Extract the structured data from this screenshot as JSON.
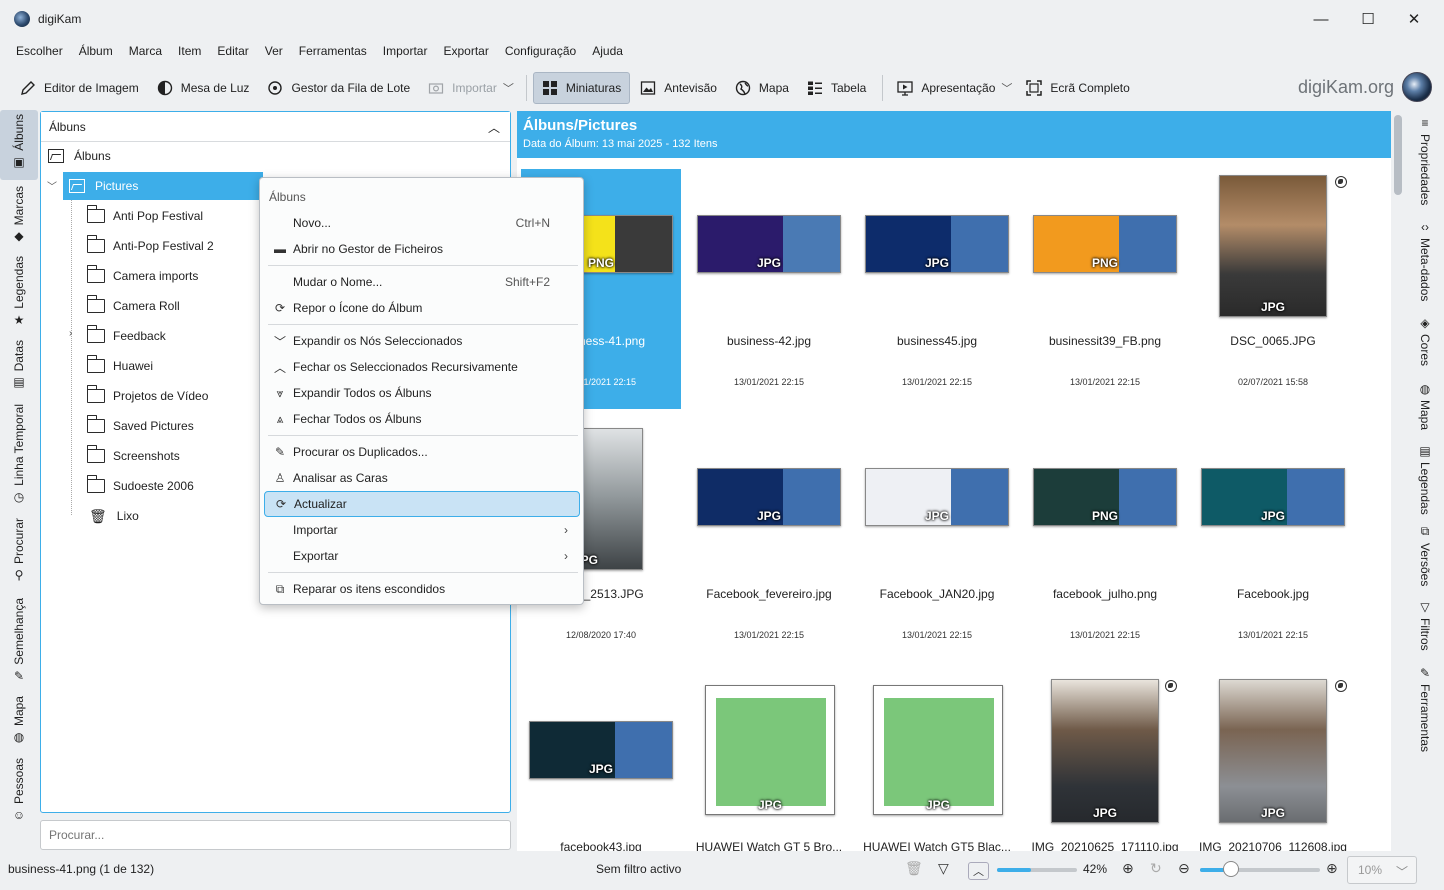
{
  "window": {
    "title": "digiKam",
    "controls": {
      "minimize": "—",
      "maximize": "☐",
      "close": "✕"
    }
  },
  "menubar": [
    "Escolher",
    "Álbum",
    "Marca",
    "Item",
    "Editar",
    "Ver",
    "Ferramentas",
    "Importar",
    "Exportar",
    "Configuração",
    "Ajuda"
  ],
  "toolbar": {
    "image_editor": "Editor de Imagem",
    "light_table": "Mesa de Luz",
    "batch_queue": "Gestor da Fila de Lote",
    "import": "Importar",
    "thumbnails": "Miniaturas",
    "preview": "Antevisão",
    "map": "Mapa",
    "table": "Tabela",
    "slideshow": "Apresentação",
    "fullscreen": "Ecrã Completo",
    "brand": "digiKam.org"
  },
  "left_tabs": [
    "Álbuns",
    "Marcas",
    "Legendas",
    "Datas",
    "Linha Temporal",
    "Procurar",
    "Semelhança",
    "Mapa",
    "Pessoas"
  ],
  "right_tabs": [
    "Propriedades",
    "Meta-dados",
    "Cores",
    "Mapa",
    "Legendas",
    "Versões",
    "Filtros",
    "Ferramentas"
  ],
  "tree": {
    "header": "Álbuns",
    "root": "Álbuns",
    "selected": "Pictures",
    "children": [
      "Anti Pop Festival",
      "Anti-Pop Festival 2",
      "Camera imports",
      "Camera Roll",
      "Feedback",
      "Huawei",
      "Projetos de Vídeo",
      "Saved Pictures",
      "Screenshots",
      "Sudoeste 2006",
      "Lixo"
    ]
  },
  "search": {
    "placeholder": "Procurar..."
  },
  "content": {
    "title": "Álbuns/Pictures",
    "subtitle": "Data do Álbum: 13 mai 2025 - 132 Itens"
  },
  "thumbnails": [
    {
      "name": "business-41.png",
      "date": "13/01/2021 22:15",
      "badge": "PNG",
      "selected": true
    },
    {
      "name": "business-42.jpg",
      "date": "13/01/2021 22:15",
      "badge": "JPG"
    },
    {
      "name": "business45.jpg",
      "date": "13/01/2021 22:15",
      "badge": "JPG"
    },
    {
      "name": "businessit39_FB.png",
      "date": "13/01/2021 22:15",
      "badge": "PNG"
    },
    {
      "name": "DSC_0065.JPG",
      "date": "02/07/2021 15:58",
      "badge": "JPG"
    },
    {
      "name": "DSC_2513.JPG",
      "date": "12/08/2020 17:40",
      "badge": "JPG"
    },
    {
      "name": "Facebook_fevereiro.jpg",
      "date": "13/01/2021 22:15",
      "badge": "JPG"
    },
    {
      "name": "Facebook_JAN20.jpg",
      "date": "13/01/2021 22:15",
      "badge": "JPG"
    },
    {
      "name": "facebook_julho.png",
      "date": "13/01/2021 22:15",
      "badge": "PNG"
    },
    {
      "name": "Facebook.jpg",
      "date": "13/01/2021 22:15",
      "badge": "JPG"
    },
    {
      "name": "facebook43.jpg",
      "date": "",
      "badge": "JPG"
    },
    {
      "name": "HUAWEI Watch GT 5 Bro...",
      "date": "",
      "badge": "JPG"
    },
    {
      "name": "HUAWEI Watch GT5 Blac...",
      "date": "",
      "badge": "JPG"
    },
    {
      "name": "IMG_20210625_171110.jpg",
      "date": "",
      "badge": "JPG"
    },
    {
      "name": "IMG_20210706_112608.jpg",
      "date": "",
      "badge": "JPG"
    }
  ],
  "context_menu": {
    "title": "Álbuns",
    "items": [
      {
        "label": "Novo...",
        "shortcut": "Ctrl+N"
      },
      {
        "label": "Abrir no Gestor de Ficheiros",
        "shortcut": ""
      },
      {
        "label": "Mudar o Nome...",
        "shortcut": "Shift+F2"
      },
      {
        "label": "Repor o Ícone do Álbum",
        "shortcut": ""
      },
      {
        "label": "Expandir os Nós Seleccionados",
        "shortcut": ""
      },
      {
        "label": "Fechar os Seleccionados Recursivamente",
        "shortcut": ""
      },
      {
        "label": "Expandir Todos os Álbuns",
        "shortcut": ""
      },
      {
        "label": "Fechar Todos os Álbuns",
        "shortcut": ""
      },
      {
        "label": "Procurar os Duplicados...",
        "shortcut": ""
      },
      {
        "label": "Analisar as Caras",
        "shortcut": ""
      },
      {
        "label": "Actualizar",
        "shortcut": ""
      },
      {
        "label": "Importar",
        "shortcut": ""
      },
      {
        "label": "Exportar",
        "shortcut": ""
      },
      {
        "label": "Reparar os itens escondidos",
        "shortcut": ""
      }
    ]
  },
  "statusbar": {
    "file": "business-41.png (1 de 132)",
    "filter": "Sem filtro activo",
    "zoom": "42%",
    "zoom_combo": "10%",
    "thumb_size_fraction": 0.42,
    "zoom_slider_fraction": 0.26
  },
  "colors": {
    "accent": "#3daee9",
    "background": "#eef0f2"
  }
}
